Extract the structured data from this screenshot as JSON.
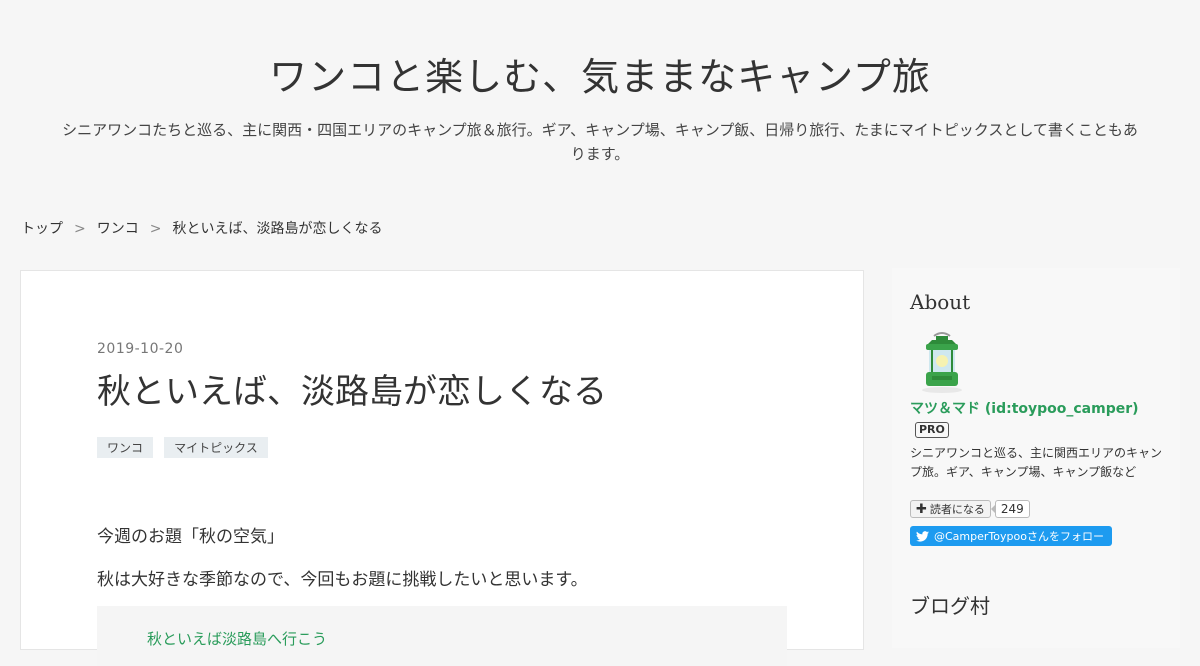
{
  "header": {
    "title": "ワンコと楽しむ、気ままなキャンプ旅",
    "description": "シニアワンコたちと巡る、主に関西・四国エリアのキャンプ旅＆旅行。ギア、キャンプ場、キャンプ飯、日帰り旅行、たまにマイトピックスとして書くこともあります。"
  },
  "breadcrumb": {
    "items": [
      "トップ",
      "ワンコ",
      "秋といえば、淡路島が恋しくなる"
    ],
    "separator": ">"
  },
  "entry": {
    "date": "2019-10-20",
    "title": "秋といえば、淡路島が恋しくなる",
    "categories": [
      "ワンコ",
      "マイトピックス"
    ],
    "paragraphs": [
      "今週のお題「秋の空気」",
      "秋は大好きな季節なので、今回もお題に挑戦したいと思います。"
    ],
    "quote_text": "秋といえば淡路島へ行こう"
  },
  "sidebar": {
    "about_title": "About",
    "profile_name": "マツ＆マド (id:toypoo_camper)",
    "pro_badge": "PRO",
    "profile_desc": "シニアワンコと巡る、主に関西エリアのキャンプ旅。ギア、キャンプ場、キャンプ飯など",
    "reader_button": "読者になる",
    "reader_count": "249",
    "twitter_follow": "@CamperToypooさんをフォロー",
    "blog_village_title": "ブログ村"
  },
  "colors": {
    "accent_green": "#2a9c5b",
    "twitter_blue": "#1d9bf0",
    "background": "#f6f6f6"
  }
}
